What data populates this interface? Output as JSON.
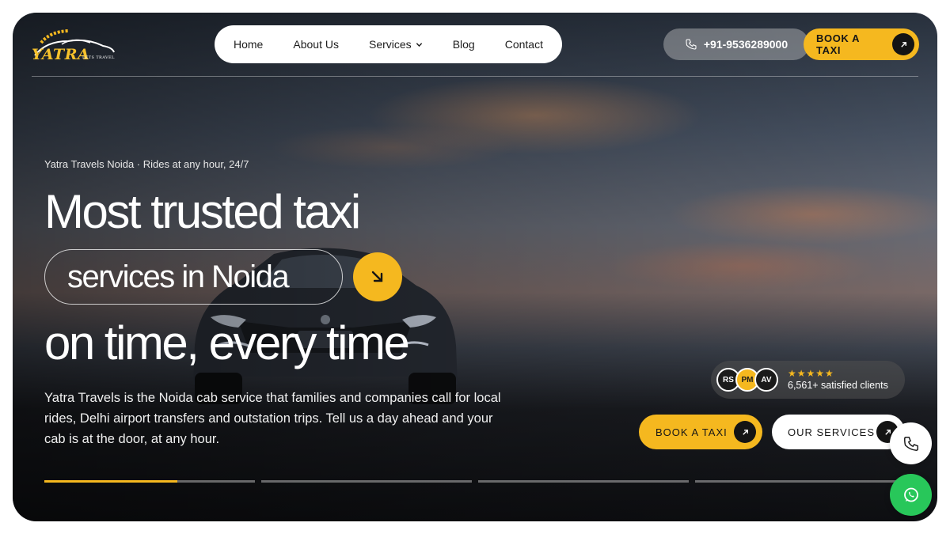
{
  "brand": {
    "name": "YATRA",
    "tagline": "LETS TRAVEL",
    "color_accent": "#f5b81f"
  },
  "nav": {
    "items": [
      {
        "label": "Home"
      },
      {
        "label": "About Us"
      },
      {
        "label": "Services",
        "has_dropdown": true
      },
      {
        "label": "Blog"
      },
      {
        "label": "Contact"
      }
    ]
  },
  "header": {
    "phone": "+91-9536289000",
    "book_label": "BOOK A TAXI"
  },
  "hero": {
    "eyebrow": "Yatra Travels Noida · Rides at any hour, 24/7",
    "headline_line1": "Most trusted taxi",
    "headline_line2": "services in Noida",
    "headline_line3": "on time, every time",
    "description": "Yatra Travels is the Noida cab service that families and companies call for local rides, Delhi airport transfers and outstation trips. Tell us a day ahead and your cab is at the door, at any hour."
  },
  "clients": {
    "avatars": [
      "RS",
      "PM",
      "AV"
    ],
    "stars": "★★★★★",
    "rating_stars": 5,
    "count_text": "6,561+ satisfied clients"
  },
  "cta": {
    "book_label": "BOOK A TAXI",
    "services_label": "OUR SERVICES"
  },
  "slider": {
    "slide_count": 4,
    "active_index": 0,
    "active_progress": 0.63
  },
  "floating": {
    "call_icon": "phone-icon",
    "whatsapp_icon": "whatsapp-icon",
    "whatsapp_color": "#28c75a"
  }
}
